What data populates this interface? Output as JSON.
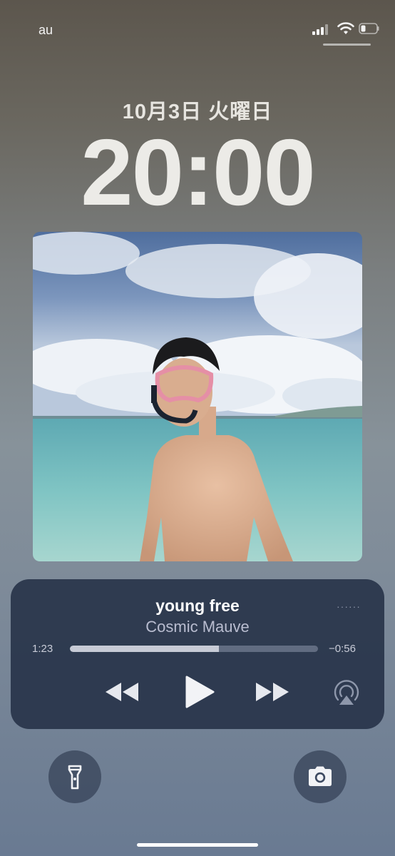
{
  "status_bar": {
    "carrier": "au",
    "signal_icon": "cellular-signal-icon",
    "wifi_icon": "wifi-icon",
    "battery_icon": "battery-icon",
    "battery_level": 0.3
  },
  "lock_screen": {
    "date": "10月3日 火曜日",
    "time": "20:00"
  },
  "now_playing": {
    "artwork_icon": "album-artwork",
    "title": "young free",
    "artist": "Cosmic Mauve",
    "elapsed": "1:23",
    "remaining": "−0:56",
    "progress": 0.6,
    "controls": {
      "rewind_icon": "rewind-icon",
      "play_icon": "play-icon",
      "forward_icon": "fast-forward-icon",
      "airplay_icon": "airplay-icon"
    },
    "colors": {
      "panel": "#28344a",
      "progress_fill": "#c7cbd6"
    }
  },
  "quick_actions": {
    "flashlight_icon": "flashlight-icon",
    "camera_icon": "camera-icon"
  }
}
